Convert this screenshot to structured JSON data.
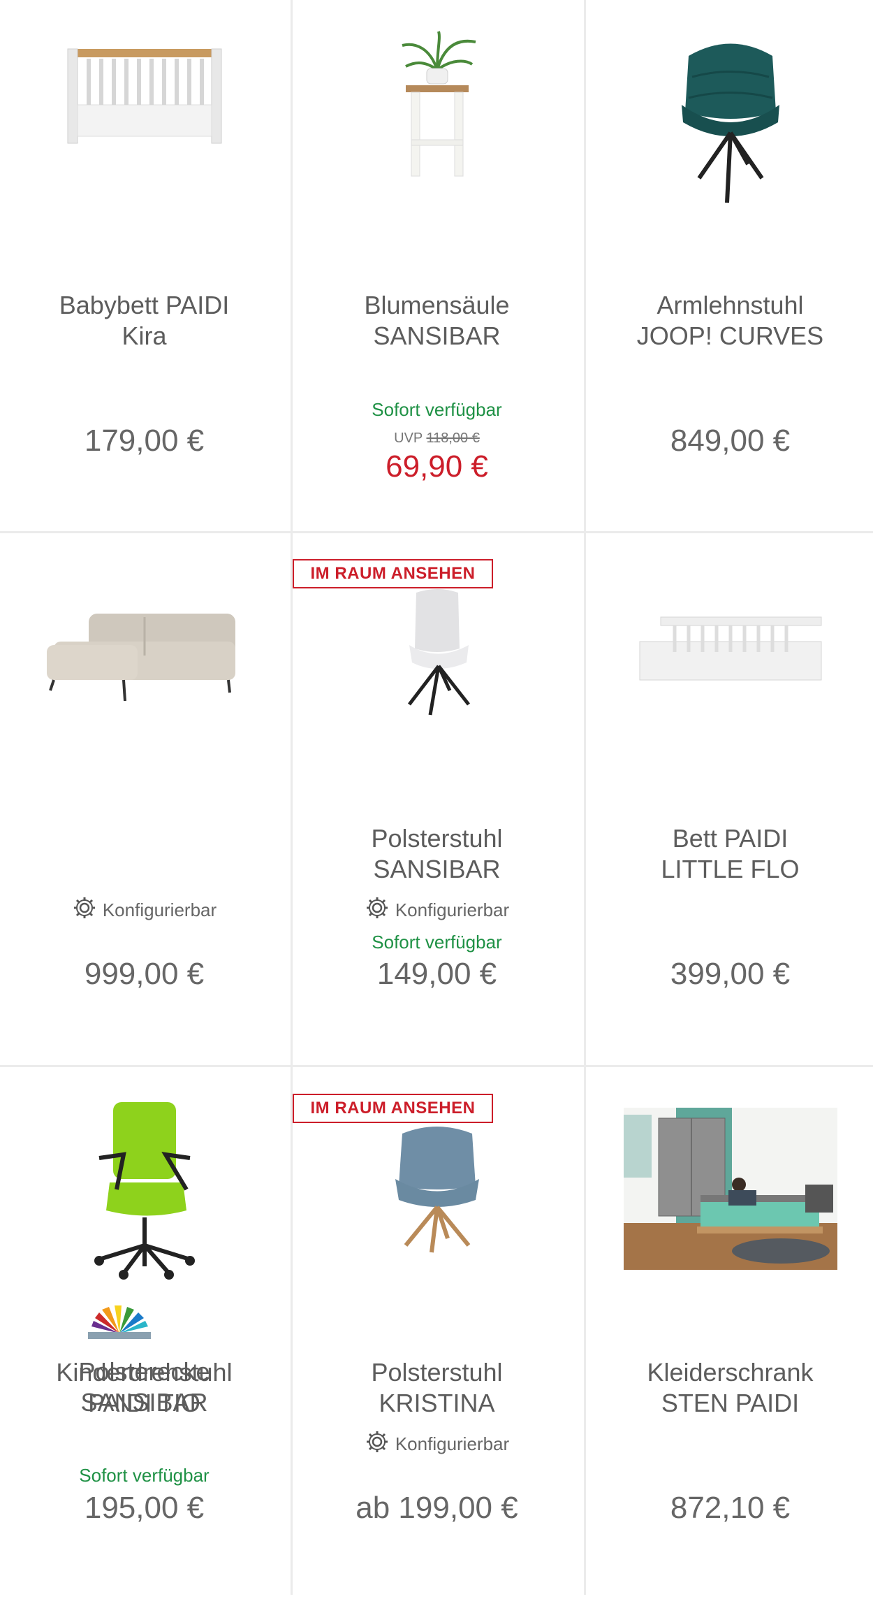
{
  "colors": {
    "text": "#5c5c5c",
    "sale": "#cc1e2a",
    "available": "#1f9145",
    "badge": "#cc1e2a",
    "divider": "#ebebeb"
  },
  "products": [
    {
      "name_line1": "Babybett PAIDI",
      "name_line2": "Kira",
      "price": "179,00 €",
      "image_icon": "crib-image"
    },
    {
      "name_line1": "Blumensäule",
      "name_line2": "SANSIBAR",
      "availability": "Sofort verfügbar",
      "uvp_label": "UVP",
      "uvp_old": "118,00 €",
      "price": "69,90 €",
      "image_icon": "plant-stand-image"
    },
    {
      "name_line1": "Armlehnstuhl",
      "name_line2": "JOOP! CURVES",
      "price": "849,00 €",
      "image_icon": "armchair-image"
    },
    {
      "name_line1": "Polsterecke",
      "name_line2": "SANSIBAR",
      "configurable": "Konfigurierbar",
      "price": "999,00 €",
      "image_icon": "corner-sofa-image"
    },
    {
      "badge": "IM RAUM ANSEHEN",
      "name_line1": "Polsterstuhl",
      "name_line2": "SANSIBAR",
      "configurable": "Konfigurierbar",
      "availability": "Sofort verfügbar",
      "price": "149,00 €",
      "image_icon": "chair-image"
    },
    {
      "name_line1": "Bett PAIDI",
      "name_line2": "LITTLE FLO",
      "price": "399,00 €",
      "image_icon": "kids-bed-image"
    },
    {
      "name_line1": "Kinderdrehstuhl",
      "name_line2": "PAIDI TIO",
      "availability": "Sofort verfügbar",
      "price": "195,00 €",
      "image_icon": "office-chair-image"
    },
    {
      "badge": "IM RAUM ANSEHEN",
      "name_line1": "Polsterstuhl",
      "name_line2": "KRISTINA",
      "configurable": "Konfigurierbar",
      "price": "ab 199,00 €",
      "image_icon": "swivel-chair-image"
    },
    {
      "name_line1": "Kleiderschrank",
      "name_line2": "STEN PAIDI",
      "price": "872,10 €",
      "image_icon": "bedroom-photo-image"
    }
  ]
}
